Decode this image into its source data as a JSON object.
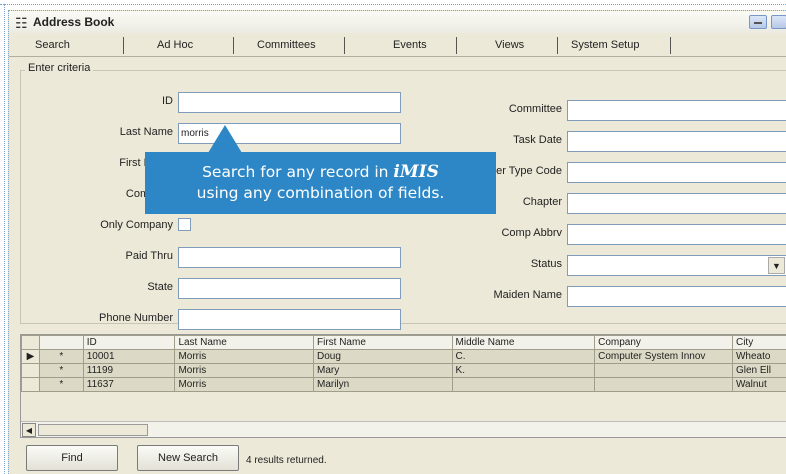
{
  "window": {
    "title": "Address Book",
    "icon": "address-book-icon"
  },
  "tabs": [
    "Search",
    "Ad Hoc",
    "Committees",
    "Events",
    "Views",
    "System Setup"
  ],
  "criteria": {
    "legend": "Enter criteria",
    "left_fields": [
      {
        "label": "ID",
        "value": ""
      },
      {
        "label": "Last Name",
        "value": "morris"
      },
      {
        "label": "First Name",
        "value": ""
      },
      {
        "label": "Company",
        "value": ""
      },
      {
        "label": "Only Company",
        "value": ""
      },
      {
        "label": "Paid Thru",
        "value": ""
      },
      {
        "label": "State",
        "value": ""
      },
      {
        "label": "Phone Number",
        "value": ""
      }
    ],
    "right_fields": [
      {
        "label": "Committee",
        "value": ""
      },
      {
        "label": "Task Date",
        "value": ""
      },
      {
        "label": "Member Type Code",
        "value": ""
      },
      {
        "label": "Chapter",
        "value": ""
      },
      {
        "label": "Comp Abbrv",
        "value": ""
      },
      {
        "label": "Status",
        "value": ""
      },
      {
        "label": "Maiden Name",
        "value": ""
      }
    ]
  },
  "results": {
    "columns": [
      "ID",
      "Last Name",
      "First Name",
      "Middle Name",
      "Company",
      "City"
    ],
    "rows": [
      [
        "10001",
        "Morris",
        "Doug",
        "C.",
        "Computer System Innov",
        "Wheato"
      ],
      [
        "11199",
        "Morris",
        "Mary",
        "K.",
        "",
        "Glen Ell"
      ],
      [
        "11637",
        "Morris",
        "Marilyn",
        "",
        "",
        "Walnut"
      ]
    ],
    "row_marker": "*"
  },
  "footer": {
    "find_label": "Find",
    "new_search_label": "New Search",
    "status": "4 results returned."
  },
  "callout": {
    "line1_prefix": "Search for any record in ",
    "line1_brand": "iMIS",
    "line2": "using any combination of fields.",
    "color": "#2d87c6"
  }
}
